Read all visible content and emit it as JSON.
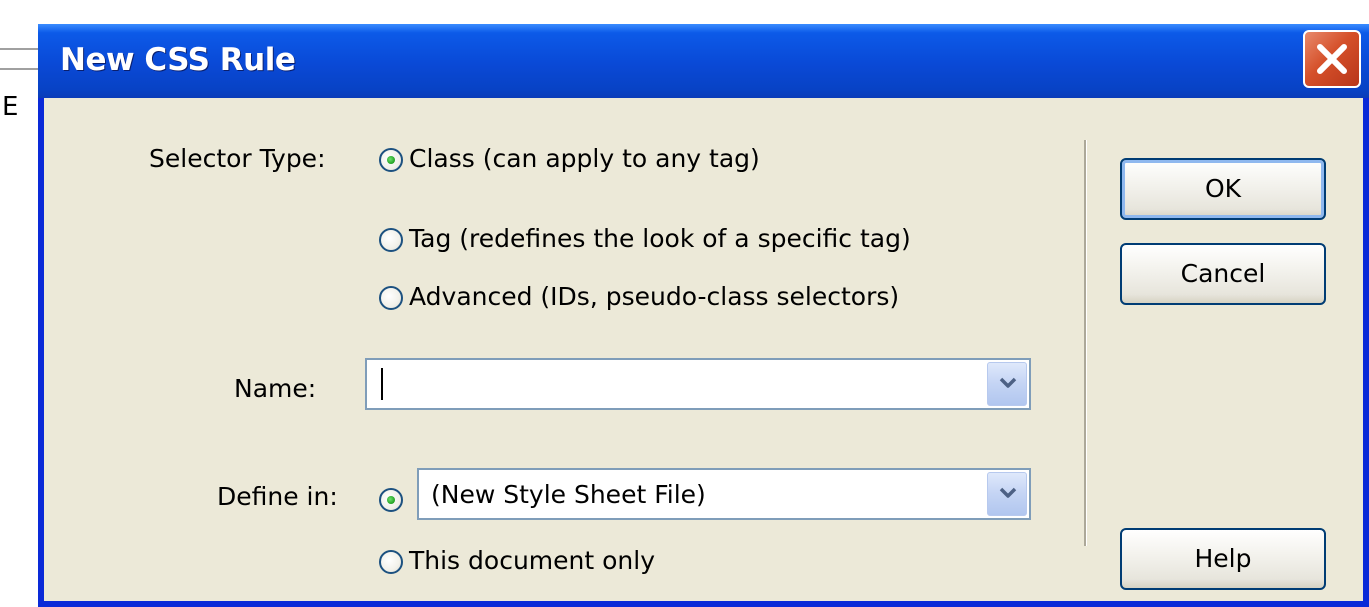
{
  "window": {
    "title": "New CSS Rule"
  },
  "background": {
    "glyph": "E"
  },
  "selector_type": {
    "label": "Selector Type:",
    "options": [
      {
        "label": "Class (can apply to any tag)",
        "checked": true
      },
      {
        "label": "Tag (redefines the look of a specific tag)",
        "checked": false
      },
      {
        "label": "Advanced (IDs, pseudo-class selectors)",
        "checked": false
      }
    ]
  },
  "name": {
    "label": "Name:",
    "value": ""
  },
  "define_in": {
    "label": "Define in:",
    "selected_value": "(New Style Sheet File)",
    "option_new_file_checked": true,
    "this_document_label": "This document only",
    "this_document_checked": false
  },
  "buttons": {
    "ok": "OK",
    "cancel": "Cancel",
    "help": "Help"
  },
  "colors": {
    "titlebar": "#0a49d6",
    "dialog_face": "#ece9d8",
    "close_button": "#d5502a",
    "radio_dot": "#21a121"
  },
  "icons": {
    "close": "close-x-icon",
    "dropdown": "chevron-down-icon"
  }
}
